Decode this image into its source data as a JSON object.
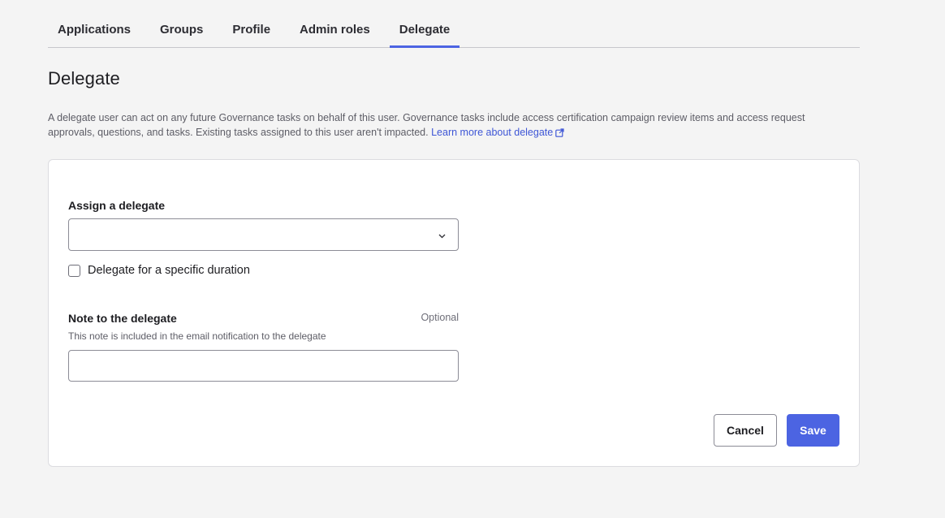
{
  "tabs": [
    {
      "label": "Applications",
      "active": false
    },
    {
      "label": "Groups",
      "active": false
    },
    {
      "label": "Profile",
      "active": false
    },
    {
      "label": "Admin roles",
      "active": false
    },
    {
      "label": "Delegate",
      "active": true
    }
  ],
  "page": {
    "title": "Delegate",
    "description": "A delegate user can act on any future Governance tasks on behalf of this user. Governance tasks include access certification campaign review items and access request approvals, questions, and tasks. Existing tasks assigned to this user aren't impacted.",
    "learn_more_label": "Learn more about delegate"
  },
  "form": {
    "assign_label": "Assign a delegate",
    "assign_value": "",
    "duration_checkbox_label": "Delegate for a specific duration",
    "duration_checked": false,
    "note_label": "Note to the delegate",
    "note_optional": "Optional",
    "note_hint": "This note is included in the email notification to the delegate",
    "note_value": ""
  },
  "actions": {
    "cancel_label": "Cancel",
    "save_label": "Save"
  },
  "colors": {
    "accent": "#4c64e2",
    "link": "#3e56d6",
    "background": "#f4f4f4"
  }
}
